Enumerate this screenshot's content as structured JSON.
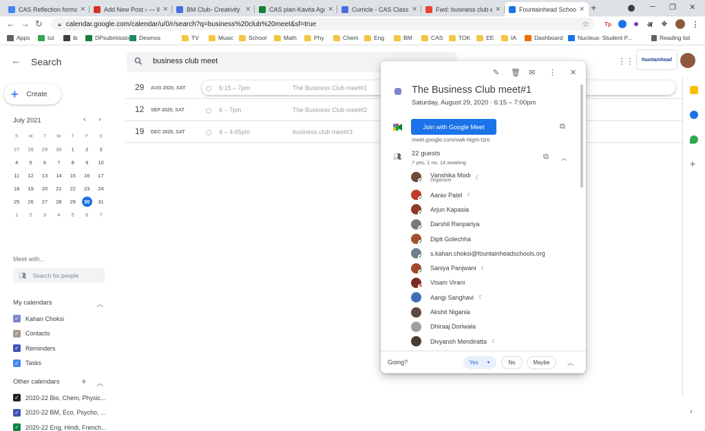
{
  "browser": {
    "tabs": [
      {
        "title": "CAS Reflection format",
        "color": "#4285f4"
      },
      {
        "title": "Add New Post ‹ — W",
        "color": "#d93025"
      },
      {
        "title": "BM Club- Creativity",
        "color": "#4a6ee0"
      },
      {
        "title": "CAS plan-Kavita Agar",
        "color": "#188038"
      },
      {
        "title": "Curricle - CAS Class o",
        "color": "#4a6ee0"
      },
      {
        "title": "Fwd: business club ev",
        "color": "#ea4335"
      },
      {
        "title": "Fountainhead School",
        "color": "#1a73e8"
      }
    ],
    "url": "calendar.google.com/calendar/u/0/r/search?q=business%20club%20meet&sf=true",
    "extensions": [
      "Tp",
      "अ"
    ],
    "bookmarks": [
      {
        "label": "Apps",
        "color": "#5f6368"
      },
      {
        "label": "tut",
        "color": "#34a853"
      },
      {
        "label": "ib",
        "color": "#3c4043"
      },
      {
        "label": "DPsubmission",
        "color": "#188038"
      },
      {
        "label": "Desmos",
        "color": "#1e8a5c"
      },
      {
        "label": "TV",
        "color": "folder"
      },
      {
        "label": "Music",
        "color": "folder"
      },
      {
        "label": "School",
        "color": "folder"
      },
      {
        "label": "Math",
        "color": "folder"
      },
      {
        "label": "Phy",
        "color": "folder"
      },
      {
        "label": "Chem",
        "color": "folder"
      },
      {
        "label": "Eng",
        "color": "folder"
      },
      {
        "label": "BM",
        "color": "folder"
      },
      {
        "label": "CAS",
        "color": "folder"
      },
      {
        "label": "TOK",
        "color": "folder"
      },
      {
        "label": "EE",
        "color": "folder"
      },
      {
        "label": "IA",
        "color": "folder"
      },
      {
        "label": "Dashboard",
        "color": "#e8710a"
      },
      {
        "label": "Nucleus- Student P...",
        "color": "#1a73e8"
      }
    ],
    "reading_list": "Reading list"
  },
  "header": {
    "search_title": "Search",
    "query": "business club meet",
    "logo_text": "fountainhead"
  },
  "sidebar": {
    "create_label": "Create",
    "month_label": "July 2021",
    "weekdays": [
      "S",
      "M",
      "T",
      "W",
      "T",
      "F",
      "S"
    ],
    "weeks": [
      [
        "27",
        "28",
        "29",
        "30",
        "1",
        "2",
        "3"
      ],
      [
        "4",
        "5",
        "6",
        "7",
        "8",
        "9",
        "10"
      ],
      [
        "11",
        "12",
        "13",
        "14",
        "15",
        "16",
        "17"
      ],
      [
        "18",
        "19",
        "20",
        "21",
        "22",
        "23",
        "24"
      ],
      [
        "25",
        "26",
        "27",
        "28",
        "29",
        "30",
        "31"
      ],
      [
        "1",
        "2",
        "3",
        "4",
        "5",
        "6",
        "7"
      ]
    ],
    "today": "30",
    "meet_with": "Meet with...",
    "people_placeholder": "Search for people",
    "my_calendars_title": "My calendars",
    "my_calendars": [
      {
        "label": "Kahan Choksi",
        "color": "#7986cb"
      },
      {
        "label": "Contacts",
        "color": "#a79b8e"
      },
      {
        "label": "Reminders",
        "color": "#3f51b5"
      },
      {
        "label": "Tasks",
        "color": "#4285f4"
      }
    ],
    "other_calendars_title": "Other calendars",
    "other_calendars": [
      {
        "label": "2020-22 Bio, Chem, Physic...",
        "color": "#202124"
      },
      {
        "label": "2020-22 BM, Eco, Psycho, ...",
        "color": "#3f51b5"
      },
      {
        "label": "2020-22 Eng, Hindi, French...",
        "color": "#0b8043"
      }
    ]
  },
  "results": [
    {
      "day": "29",
      "month_dow": "AUG 2020, SAT",
      "time": "6:15 – 7pm",
      "title": "The Business Club meet#1"
    },
    {
      "day": "12",
      "month_dow": "SEP 2020, SAT",
      "time": "6 – 7pm",
      "title": "The Business Club meet#2"
    },
    {
      "day": "19",
      "month_dow": "DEC 2020, SAT",
      "time": "4 – 4:45pm",
      "title": "business club meet#3"
    }
  ],
  "event": {
    "title": "The Business Club meet#1",
    "date": "Saturday, August 29, 2020  ⋅  6:15 – 7:00pm",
    "join_label": "Join with Google Meet",
    "meet_link": "meet.google.com/owk-higm-tzm",
    "guest_count": "22 guests",
    "guest_summary": "7 yes, 1 no, 14 awaiting",
    "organizer_label": "Organizer",
    "guests": [
      {
        "name": "Vanshika Modi",
        "status": "yes",
        "moon": true,
        "organizer": true,
        "color": "#6d4c3d"
      },
      {
        "name": "Aarav Patel",
        "status": "yes",
        "moon": true,
        "color": "#c0392b"
      },
      {
        "name": "Arjun Kapasia",
        "status": "yes",
        "moon": false,
        "color": "#8e3b2a"
      },
      {
        "name": "Darshil Ranpariya",
        "status": "yes",
        "moon": false,
        "color": "#7a7a7a"
      },
      {
        "name": "Dipit Golechha",
        "status": "yes",
        "moon": false,
        "color": "#a0522d"
      },
      {
        "name": "s.kahan.choksi@fountainheadschools.org",
        "status": "yes",
        "moon": false,
        "color": "#6e7f8d"
      },
      {
        "name": "Saniya Panjwani",
        "status": "yes",
        "moon": true,
        "color": "#9e4a2f"
      },
      {
        "name": "Visam Virani",
        "status": "no",
        "moon": false,
        "color": "#7d2c25"
      },
      {
        "name": "Aangi Sanghavi",
        "status": "",
        "moon": true,
        "color": "#3b6fb6"
      },
      {
        "name": "Akshit Nigania",
        "status": "",
        "moon": false,
        "color": "#5c4a3f"
      },
      {
        "name": "Dhiraaj Doriwala",
        "status": "",
        "moon": false,
        "color": "#9e9e9e"
      },
      {
        "name": "Divyansh Mendiratta",
        "status": "",
        "moon": true,
        "color": "#4a3b34"
      }
    ],
    "going_label": "Going?",
    "rsvp_yes": "Yes",
    "rsvp_no": "No",
    "rsvp_maybe": "Maybe"
  }
}
